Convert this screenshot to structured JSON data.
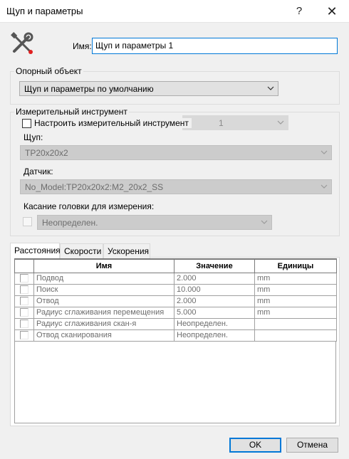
{
  "window": {
    "title": "Щуп и параметры",
    "help_glyph": "?",
    "close_glyph": "✕"
  },
  "header": {
    "icon": "tools-icon",
    "name_label": "Имя:",
    "name_value": "Щуп и параметры 1"
  },
  "reference": {
    "group_title": "Опорный объект",
    "selected": "Щуп и параметры по умолчанию"
  },
  "instrument": {
    "group_title": "Измерительный инструмент",
    "configure_label": "Настроить измерительный инструмент",
    "configure_checked": false,
    "hidden_combo_fragment": "1",
    "probe_label": "Щуп:",
    "probe_value": "TP20x20x2",
    "sensor_label": "Датчик:",
    "sensor_value": "No_Model:TP20x20x2:M2_20x2_SS",
    "touch_label": "Касание головки для измерения:",
    "touch_value": "Неопределен."
  },
  "tabs": [
    {
      "label": "Расстояния",
      "active": true
    },
    {
      "label": "Скорости",
      "active": false
    },
    {
      "label": "Ускорения",
      "active": false
    }
  ],
  "table": {
    "columns": [
      "",
      "Имя",
      "Значение",
      "Единицы"
    ],
    "rows": [
      {
        "name": "Подвод",
        "value": "2.000",
        "unit": "mm"
      },
      {
        "name": "Поиск",
        "value": "10.000",
        "unit": "mm"
      },
      {
        "name": "Отвод",
        "value": "2.000",
        "unit": "mm"
      },
      {
        "name": "Радиус сглаживания перемещения",
        "value": "5.000",
        "unit": "mm"
      },
      {
        "name": "Радиус сглаживания скан-я",
        "value": "Неопределен.",
        "unit": ""
      },
      {
        "name": "Отвод сканирования",
        "value": "Неопределен.",
        "unit": ""
      }
    ]
  },
  "buttons": {
    "ok": "OK",
    "cancel": "Отмена"
  },
  "colors": {
    "accent": "#0078d7",
    "disabled_fill": "#cccccc",
    "disabled_text": "#6d6d6d"
  }
}
